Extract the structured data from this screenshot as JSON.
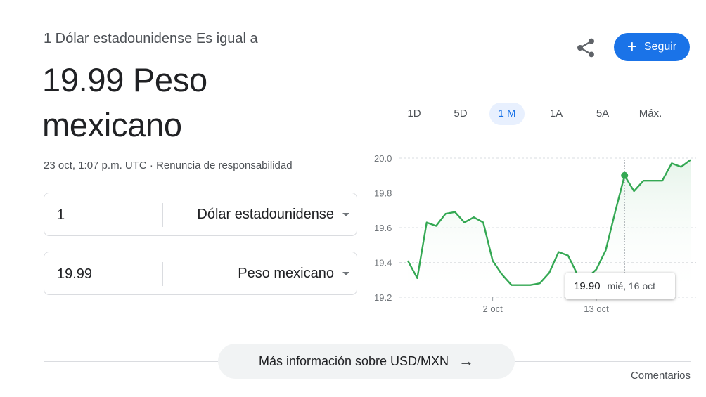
{
  "header": {
    "subtitle": "1 Dólar estadounidense Es igual a",
    "value": "19.99 Peso mexicano",
    "timestamp": "23 oct, 1:07 p.m. UTC",
    "separator": "·",
    "disclaimer": "Renuncia de responsabilidad"
  },
  "actions": {
    "share_icon": "share-icon",
    "follow_label": "Seguir",
    "follow_icon": "+"
  },
  "converter": {
    "from": {
      "amount": "1",
      "currency": "Dólar estadounidense"
    },
    "to": {
      "amount": "19.99",
      "currency": "Peso mexicano"
    }
  },
  "ranges": {
    "items": [
      "1D",
      "5D",
      "1 M",
      "1A",
      "5A",
      "Máx."
    ],
    "active": "1 M"
  },
  "tooltip": {
    "value": "19.90",
    "date": "mié, 16 oct"
  },
  "colors": {
    "accent": "#1a73e8",
    "line": "#34a853",
    "fill": "#e6f4ea"
  },
  "chart_data": {
    "type": "area",
    "yticks": [
      "20.0",
      "19.8",
      "19.6",
      "19.4",
      "19.2"
    ],
    "ylim": [
      19.2,
      20.0
    ],
    "xticks": [
      "2 oct",
      "13 oct"
    ],
    "series": [
      {
        "x": [
          "23 sept",
          "24 sept",
          "25 sept",
          "26 sept",
          "27 sept",
          "28 sept",
          "29 sept",
          "30 sept",
          "1 oct",
          "2 oct",
          "3 oct",
          "4 oct",
          "5 oct",
          "6 oct",
          "7 oct",
          "8 oct",
          "9 oct",
          "10 oct",
          "11 oct",
          "12 oct",
          "13 oct",
          "14 oct",
          "15 oct",
          "16 oct",
          "17 oct",
          "18 oct",
          "19 oct",
          "20 oct",
          "21 oct",
          "22 oct",
          "23 oct"
        ],
        "values": [
          19.41,
          19.31,
          19.63,
          19.61,
          19.68,
          19.69,
          19.63,
          19.66,
          19.63,
          19.41,
          19.33,
          19.27,
          19.27,
          19.27,
          19.28,
          19.34,
          19.46,
          19.44,
          19.33,
          19.31,
          19.36,
          19.47,
          19.69,
          19.9,
          19.81,
          19.87,
          19.87,
          19.87,
          19.97,
          19.95,
          19.99
        ]
      }
    ]
  },
  "footer": {
    "more_label": "Más información sobre USD/MXN",
    "more_arrow": "→",
    "feedback": "Comentarios"
  }
}
